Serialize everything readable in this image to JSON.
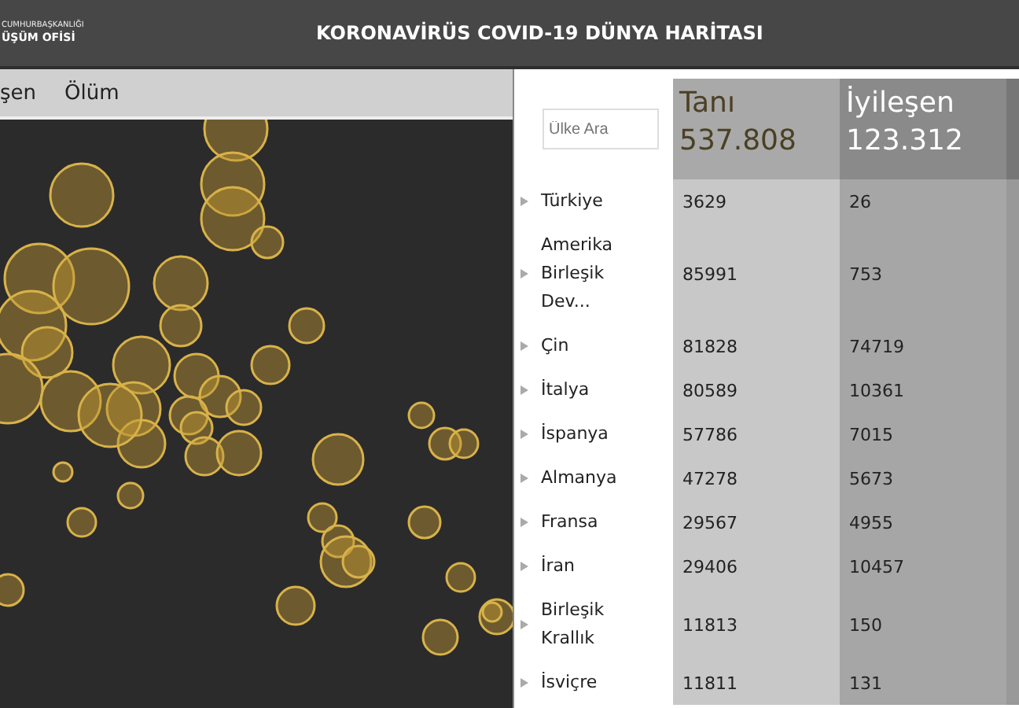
{
  "header": {
    "logo_top": "CUMHURBAŞKANLIĞI",
    "logo_bottom": "ÜŞÜM OFİSİ",
    "title": "KORONAVİRÜS COVID-19 DÜNYA HARİTASI"
  },
  "map_tabs": [
    {
      "label": "şen"
    },
    {
      "label": "Ölüm"
    }
  ],
  "search": {
    "placeholder": "Ülke Ara"
  },
  "columns": [
    {
      "label": "Tanı",
      "total": "537.808"
    },
    {
      "label": "İyileşen",
      "total": "123.312"
    }
  ],
  "rows": [
    {
      "name": "Türkiye",
      "values": [
        "3629",
        "26"
      ]
    },
    {
      "name": "Amerika Birleşik Dev...",
      "values": [
        "85991",
        "753"
      ]
    },
    {
      "name": "Çin",
      "values": [
        "81828",
        "74719"
      ]
    },
    {
      "name": "İtalya",
      "values": [
        "80589",
        "10361"
      ]
    },
    {
      "name": "İspanya",
      "values": [
        "57786",
        "7015"
      ]
    },
    {
      "name": "Almanya",
      "values": [
        "47278",
        "5673"
      ]
    },
    {
      "name": "Fransa",
      "values": [
        "29567",
        "4955"
      ]
    },
    {
      "name": "İran",
      "values": [
        "29406",
        "10457"
      ]
    },
    {
      "name": "Birleşik Krallık",
      "values": [
        "11813",
        "150"
      ]
    },
    {
      "name": "İsviçre",
      "values": [
        "11811",
        "131"
      ]
    }
  ]
}
